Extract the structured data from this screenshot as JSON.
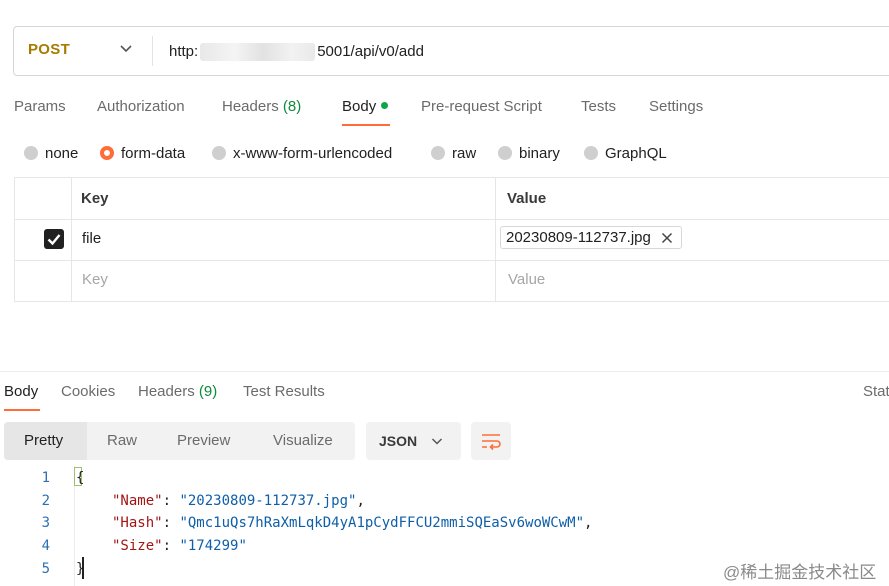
{
  "request": {
    "method": "POST",
    "url_prefix": "http:",
    "url_suffix": "5001/api/v0/add"
  },
  "request_tabs": [
    {
      "label": "Params"
    },
    {
      "label": "Authorization"
    },
    {
      "label": "Headers",
      "count": "(8)"
    },
    {
      "label": "Body",
      "active": true
    },
    {
      "label": "Pre-request Script"
    },
    {
      "label": "Tests"
    },
    {
      "label": "Settings"
    }
  ],
  "body_types": [
    {
      "label": "none"
    },
    {
      "label": "form-data",
      "selected": true
    },
    {
      "label": "x-www-form-urlencoded"
    },
    {
      "label": "raw"
    },
    {
      "label": "binary"
    },
    {
      "label": "GraphQL"
    }
  ],
  "form_table": {
    "headers": {
      "key": "Key",
      "value": "Value"
    },
    "rows": [
      {
        "checked": true,
        "key": "file",
        "value": "20230809-112737.jpg"
      }
    ],
    "placeholder": {
      "key": "Key",
      "value": "Value"
    }
  },
  "response_tabs": [
    {
      "label": "Body",
      "active": true
    },
    {
      "label": "Cookies"
    },
    {
      "label": "Headers",
      "count": "(9)"
    },
    {
      "label": "Test Results"
    }
  ],
  "response_status_label": "Stat",
  "view_modes": [
    "Pretty",
    "Raw",
    "Preview",
    "Visualize"
  ],
  "format": "JSON",
  "code": {
    "line_numbers": [
      "1",
      "2",
      "3",
      "4",
      "5"
    ],
    "open_brace": "{",
    "close_brace": "}",
    "fields": [
      {
        "key": "\"Name\"",
        "value": "\"20230809-112737.jpg\"",
        "trailing": ","
      },
      {
        "key": "\"Hash\"",
        "value": "\"Qmc1uQs7hRaXmLqkD4yA1pCydFFCU2mmiSQEaSv6woWCwM\"",
        "trailing": ","
      },
      {
        "key": "\"Size\"",
        "value": "\"174299\"",
        "trailing": ""
      }
    ]
  },
  "watermark": "@稀土掘金技术社区",
  "colors": {
    "accent": "#ff6c37",
    "method": "#a77b00",
    "count": "#0d8a3c"
  }
}
